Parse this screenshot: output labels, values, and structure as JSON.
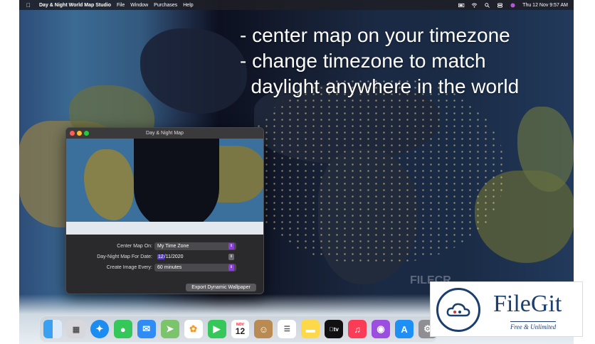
{
  "menubar": {
    "app_name": "Day & Night World Map Studio",
    "menus": [
      "File",
      "Window",
      "Purchases",
      "Help"
    ],
    "clock": "Thu 12 Nov  9:57 AM"
  },
  "promo": {
    "lines": [
      "- center map on your timezone",
      "- change timezone to match",
      "  daylight anywhere in the world"
    ]
  },
  "window": {
    "title": "Day & Night Map",
    "center_label": "Center Map On:",
    "center_value": "My Time Zone",
    "date_label": "Day-Night Map For Date:",
    "date_day": "12",
    "date_rest": "/11/2020",
    "interval_label": "Create Image Every:",
    "interval_value": "60 minutes",
    "export_label": "Export Dynamic Wallpaper"
  },
  "dock": {
    "calendar_month": "NOV",
    "calendar_day": "12",
    "appletv_label": "tv"
  },
  "watermark_mid": "FILECR",
  "filegit": {
    "title": "FileGit",
    "subtitle": "Free & Unlimited"
  },
  "icons": [
    "apple-icon",
    "battery-icon",
    "wifi-icon",
    "spotlight-icon",
    "control-center-icon",
    "siri-icon",
    "finder-icon",
    "launchpad-icon",
    "safari-icon",
    "messages-icon",
    "mail-icon",
    "maps-icon",
    "photos-icon",
    "facetime-icon",
    "calendar-icon",
    "contacts-icon",
    "reminders-icon",
    "notes-icon",
    "appletv-icon",
    "music-icon",
    "podcasts-icon",
    "appstore-icon",
    "settings-icon"
  ]
}
